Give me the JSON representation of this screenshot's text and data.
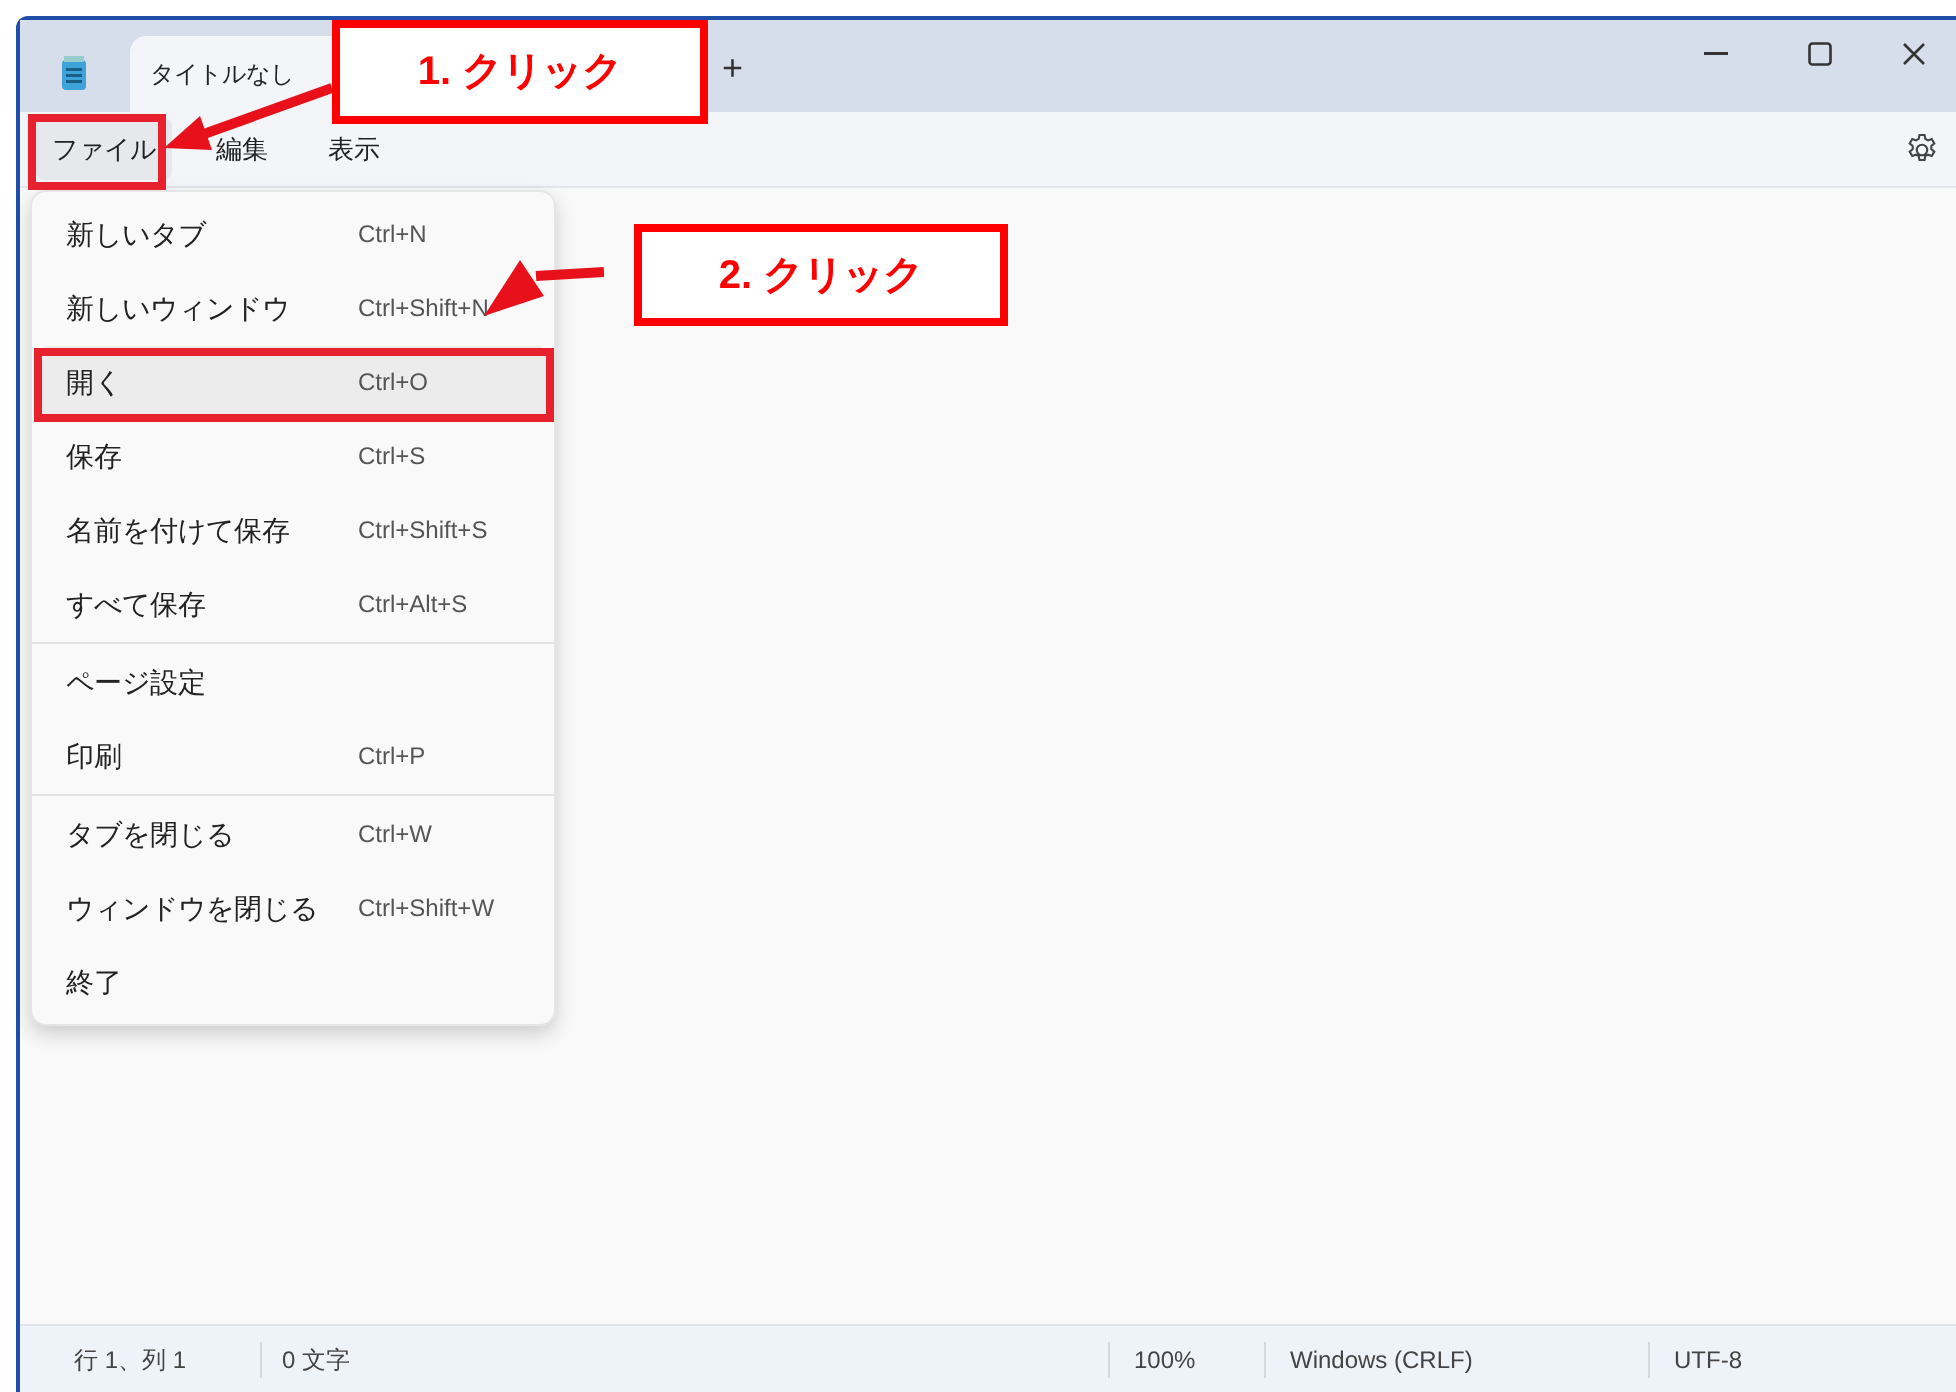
{
  "window": {
    "tab_title": "タイトルなし",
    "new_tab": "+"
  },
  "menu_bar": [
    {
      "label": "ファイル",
      "selected": true
    },
    {
      "label": "編集",
      "selected": false
    },
    {
      "label": "表示",
      "selected": false
    }
  ],
  "file_menu": [
    {
      "label": "新しいタブ",
      "shortcut": "Ctrl+N",
      "selected": false,
      "separator_after": false
    },
    {
      "label": "新しいウィンドウ",
      "shortcut": "Ctrl+Shift+N",
      "selected": false,
      "separator_after": false
    },
    {
      "label": "開く",
      "shortcut": "Ctrl+O",
      "selected": true,
      "separator_after": false
    },
    {
      "label": "保存",
      "shortcut": "Ctrl+S",
      "selected": false,
      "separator_after": false
    },
    {
      "label": "名前を付けて保存",
      "shortcut": "Ctrl+Shift+S",
      "selected": false,
      "separator_after": false
    },
    {
      "label": "すべて保存",
      "shortcut": "Ctrl+Alt+S",
      "selected": false,
      "separator_after": true
    },
    {
      "label": "ページ設定",
      "selected": false,
      "separator_after": false
    },
    {
      "label": "印刷",
      "shortcut": "Ctrl+P",
      "selected": false,
      "separator_after": true
    },
    {
      "label": "タブを閉じる",
      "shortcut": "Ctrl+W",
      "selected": false,
      "separator_after": false
    },
    {
      "label": "ウィンドウを閉じる",
      "shortcut": "Ctrl+Shift+W",
      "selected": false,
      "separator_after": false
    },
    {
      "label": "終了",
      "selected": false,
      "separator_after": false
    }
  ],
  "annotations": [
    {
      "text": "1. クリック"
    },
    {
      "text": "2. クリック"
    }
  ],
  "status_bar": {
    "position": "行 1、列 1",
    "characters": "0 文字",
    "zoom": "100%",
    "line_ending": "Windows (CRLF)",
    "encoding": "UTF-8"
  }
}
